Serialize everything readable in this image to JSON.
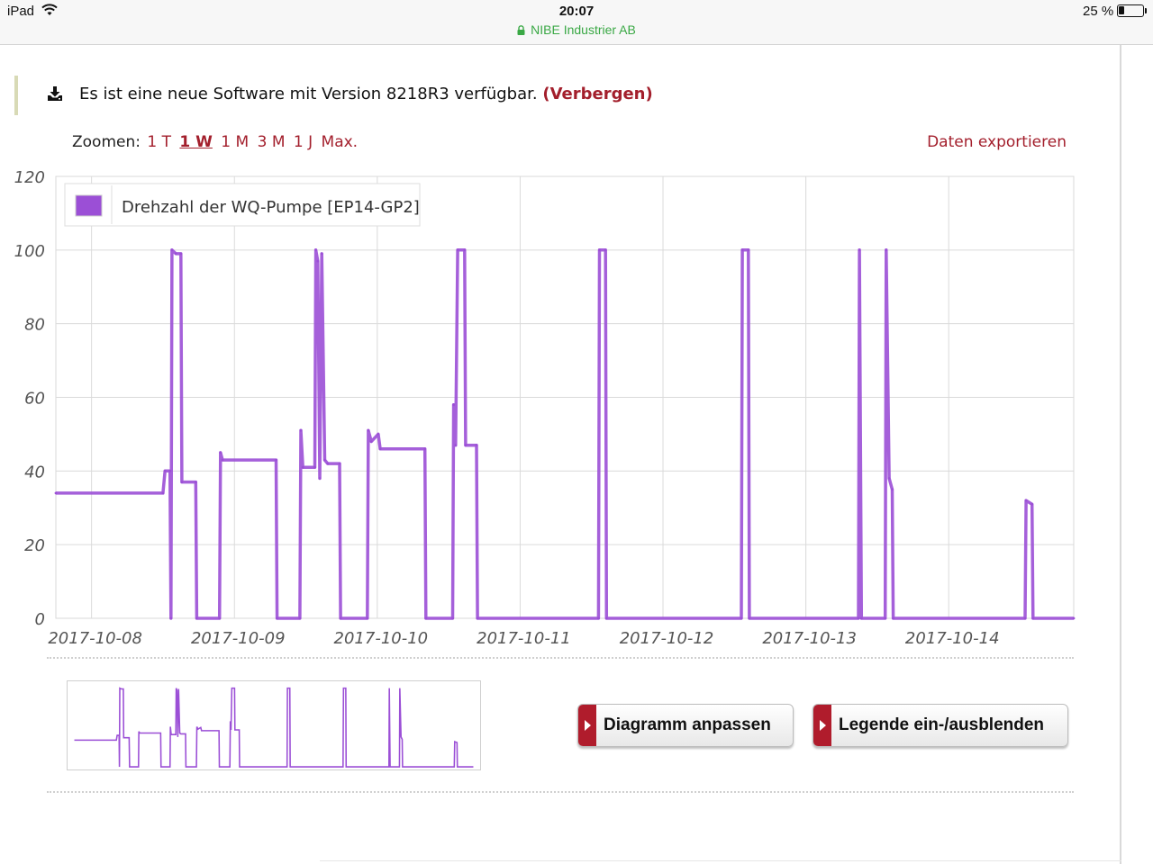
{
  "status_bar": {
    "device": "iPad",
    "time": "20:07",
    "site": "NIBE Industrier AB",
    "battery_text": "25 %",
    "battery_level": 0.25
  },
  "notice": {
    "text": "Es ist eine neue Software mit Version 8218R3 verfügbar.",
    "hide_label": "(Verbergen)",
    "icon": "download-icon"
  },
  "zoom": {
    "label": "Zoomen:",
    "options": [
      "1 T",
      "1 W",
      "1 M",
      "3 M",
      "1 J",
      "Max."
    ],
    "active": "1 W"
  },
  "export_label": "Daten exportieren",
  "buttons": {
    "diagram": "Diagramm anpassen",
    "legend": "Legende ein-/ausblenden"
  },
  "colors": {
    "series": "#9b4fd6",
    "accent": "#a31f2c",
    "button_tab": "#b01c2c"
  },
  "chart_data": {
    "type": "line",
    "title": "",
    "xlabel": "",
    "ylabel": "",
    "ylim": [
      0,
      120
    ],
    "yticks": [
      0,
      20,
      40,
      60,
      80,
      100,
      120
    ],
    "x_ticks": [
      "2017-10-08",
      "2017-10-09",
      "2017-10-10",
      "2017-10-11",
      "2017-10-12",
      "2017-10-13",
      "2017-10-14"
    ],
    "xlim": [
      "2017-10-07 18:00",
      "2017-10-14 21:00"
    ],
    "grid": true,
    "legend_position": "top-left",
    "series": [
      {
        "name": "Drehzahl der WQ-Pumpe [EP14-GP2]",
        "points": [
          [
            "2017-10-07 18:00",
            34
          ],
          [
            "2017-10-08 12:00",
            34
          ],
          [
            "2017-10-08 12:20",
            40
          ],
          [
            "2017-10-08 13:10",
            40
          ],
          [
            "2017-10-08 13:20",
            0
          ],
          [
            "2017-10-08 13:30",
            100
          ],
          [
            "2017-10-08 14:10",
            99
          ],
          [
            "2017-10-08 15:00",
            99
          ],
          [
            "2017-10-08 15:10",
            37
          ],
          [
            "2017-10-08 17:30",
            37
          ],
          [
            "2017-10-08 17:40",
            0
          ],
          [
            "2017-10-08 21:30",
            0
          ],
          [
            "2017-10-08 21:40",
            45
          ],
          [
            "2017-10-08 22:00",
            43
          ],
          [
            "2017-10-09 07:00",
            43
          ],
          [
            "2017-10-09 07:10",
            0
          ],
          [
            "2017-10-09 11:00",
            0
          ],
          [
            "2017-10-09 11:10",
            51
          ],
          [
            "2017-10-09 11:30",
            41
          ],
          [
            "2017-10-09 13:30",
            41
          ],
          [
            "2017-10-09 13:40",
            100
          ],
          [
            "2017-10-09 14:00",
            97
          ],
          [
            "2017-10-09 14:20",
            38
          ],
          [
            "2017-10-09 14:40",
            99
          ],
          [
            "2017-10-09 15:10",
            43
          ],
          [
            "2017-10-09 15:40",
            42
          ],
          [
            "2017-10-09 17:40",
            42
          ],
          [
            "2017-10-09 17:50",
            0
          ],
          [
            "2017-10-09 22:20",
            0
          ],
          [
            "2017-10-09 22:30",
            51
          ],
          [
            "2017-10-09 23:00",
            48
          ],
          [
            "2017-10-10 00:10",
            50
          ],
          [
            "2017-10-10 00:30",
            46
          ],
          [
            "2017-10-10 08:00",
            46
          ],
          [
            "2017-10-10 08:10",
            0
          ],
          [
            "2017-10-10 12:40",
            0
          ],
          [
            "2017-10-10 12:50",
            58
          ],
          [
            "2017-10-10 13:10",
            47
          ],
          [
            "2017-10-10 13:30",
            100
          ],
          [
            "2017-10-10 14:40",
            100
          ],
          [
            "2017-10-10 14:50",
            47
          ],
          [
            "2017-10-10 16:40",
            47
          ],
          [
            "2017-10-10 16:50",
            0
          ],
          [
            "2017-10-11 13:10",
            0
          ],
          [
            "2017-10-11 13:20",
            100
          ],
          [
            "2017-10-11 14:20",
            100
          ],
          [
            "2017-10-11 14:30",
            0
          ],
          [
            "2017-10-12 13:10",
            0
          ],
          [
            "2017-10-12 13:20",
            100
          ],
          [
            "2017-10-12 14:20",
            100
          ],
          [
            "2017-10-12 14:30",
            0
          ],
          [
            "2017-10-13 08:50",
            0
          ],
          [
            "2017-10-13 09:00",
            100
          ],
          [
            "2017-10-13 09:20",
            0
          ],
          [
            "2017-10-13 13:20",
            0
          ],
          [
            "2017-10-13 13:30",
            100
          ],
          [
            "2017-10-13 14:00",
            38
          ],
          [
            "2017-10-13 14:30",
            35
          ],
          [
            "2017-10-13 14:40",
            0
          ],
          [
            "2017-10-14 12:50",
            0
          ],
          [
            "2017-10-14 13:00",
            32
          ],
          [
            "2017-10-14 14:00",
            31
          ],
          [
            "2017-10-14 14:10",
            0
          ],
          [
            "2017-10-14 21:00",
            0
          ]
        ]
      }
    ]
  }
}
